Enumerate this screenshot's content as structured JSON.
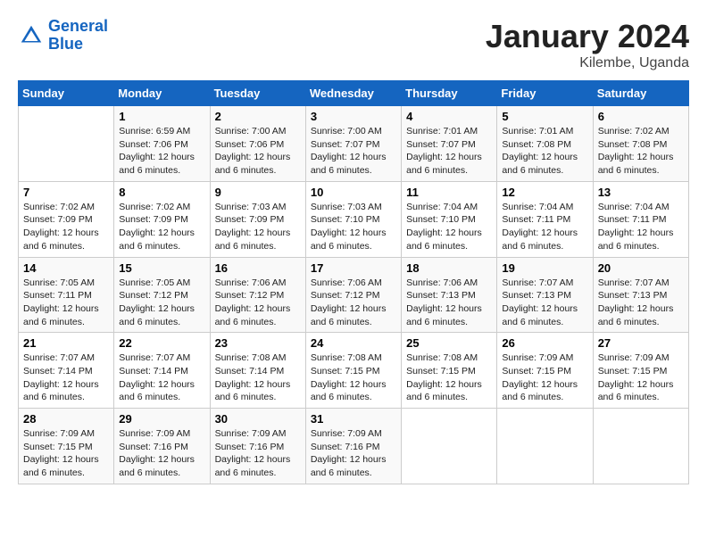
{
  "header": {
    "logo_line1": "General",
    "logo_line2": "Blue",
    "month_year": "January 2024",
    "location": "Kilembe, Uganda"
  },
  "weekdays": [
    "Sunday",
    "Monday",
    "Tuesday",
    "Wednesday",
    "Thursday",
    "Friday",
    "Saturday"
  ],
  "weeks": [
    [
      {
        "day": "",
        "sunrise": "",
        "sunset": "",
        "daylight": ""
      },
      {
        "day": "1",
        "sunrise": "Sunrise: 6:59 AM",
        "sunset": "Sunset: 7:06 PM",
        "daylight": "Daylight: 12 hours and 6 minutes."
      },
      {
        "day": "2",
        "sunrise": "Sunrise: 7:00 AM",
        "sunset": "Sunset: 7:06 PM",
        "daylight": "Daylight: 12 hours and 6 minutes."
      },
      {
        "day": "3",
        "sunrise": "Sunrise: 7:00 AM",
        "sunset": "Sunset: 7:07 PM",
        "daylight": "Daylight: 12 hours and 6 minutes."
      },
      {
        "day": "4",
        "sunrise": "Sunrise: 7:01 AM",
        "sunset": "Sunset: 7:07 PM",
        "daylight": "Daylight: 12 hours and 6 minutes."
      },
      {
        "day": "5",
        "sunrise": "Sunrise: 7:01 AM",
        "sunset": "Sunset: 7:08 PM",
        "daylight": "Daylight: 12 hours and 6 minutes."
      },
      {
        "day": "6",
        "sunrise": "Sunrise: 7:02 AM",
        "sunset": "Sunset: 7:08 PM",
        "daylight": "Daylight: 12 hours and 6 minutes."
      }
    ],
    [
      {
        "day": "7",
        "sunrise": "Sunrise: 7:02 AM",
        "sunset": "Sunset: 7:09 PM",
        "daylight": "Daylight: 12 hours and 6 minutes."
      },
      {
        "day": "8",
        "sunrise": "Sunrise: 7:02 AM",
        "sunset": "Sunset: 7:09 PM",
        "daylight": "Daylight: 12 hours and 6 minutes."
      },
      {
        "day": "9",
        "sunrise": "Sunrise: 7:03 AM",
        "sunset": "Sunset: 7:09 PM",
        "daylight": "Daylight: 12 hours and 6 minutes."
      },
      {
        "day": "10",
        "sunrise": "Sunrise: 7:03 AM",
        "sunset": "Sunset: 7:10 PM",
        "daylight": "Daylight: 12 hours and 6 minutes."
      },
      {
        "day": "11",
        "sunrise": "Sunrise: 7:04 AM",
        "sunset": "Sunset: 7:10 PM",
        "daylight": "Daylight: 12 hours and 6 minutes."
      },
      {
        "day": "12",
        "sunrise": "Sunrise: 7:04 AM",
        "sunset": "Sunset: 7:11 PM",
        "daylight": "Daylight: 12 hours and 6 minutes."
      },
      {
        "day": "13",
        "sunrise": "Sunrise: 7:04 AM",
        "sunset": "Sunset: 7:11 PM",
        "daylight": "Daylight: 12 hours and 6 minutes."
      }
    ],
    [
      {
        "day": "14",
        "sunrise": "Sunrise: 7:05 AM",
        "sunset": "Sunset: 7:11 PM",
        "daylight": "Daylight: 12 hours and 6 minutes."
      },
      {
        "day": "15",
        "sunrise": "Sunrise: 7:05 AM",
        "sunset": "Sunset: 7:12 PM",
        "daylight": "Daylight: 12 hours and 6 minutes."
      },
      {
        "day": "16",
        "sunrise": "Sunrise: 7:06 AM",
        "sunset": "Sunset: 7:12 PM",
        "daylight": "Daylight: 12 hours and 6 minutes."
      },
      {
        "day": "17",
        "sunrise": "Sunrise: 7:06 AM",
        "sunset": "Sunset: 7:12 PM",
        "daylight": "Daylight: 12 hours and 6 minutes."
      },
      {
        "day": "18",
        "sunrise": "Sunrise: 7:06 AM",
        "sunset": "Sunset: 7:13 PM",
        "daylight": "Daylight: 12 hours and 6 minutes."
      },
      {
        "day": "19",
        "sunrise": "Sunrise: 7:07 AM",
        "sunset": "Sunset: 7:13 PM",
        "daylight": "Daylight: 12 hours and 6 minutes."
      },
      {
        "day": "20",
        "sunrise": "Sunrise: 7:07 AM",
        "sunset": "Sunset: 7:13 PM",
        "daylight": "Daylight: 12 hours and 6 minutes."
      }
    ],
    [
      {
        "day": "21",
        "sunrise": "Sunrise: 7:07 AM",
        "sunset": "Sunset: 7:14 PM",
        "daylight": "Daylight: 12 hours and 6 minutes."
      },
      {
        "day": "22",
        "sunrise": "Sunrise: 7:07 AM",
        "sunset": "Sunset: 7:14 PM",
        "daylight": "Daylight: 12 hours and 6 minutes."
      },
      {
        "day": "23",
        "sunrise": "Sunrise: 7:08 AM",
        "sunset": "Sunset: 7:14 PM",
        "daylight": "Daylight: 12 hours and 6 minutes."
      },
      {
        "day": "24",
        "sunrise": "Sunrise: 7:08 AM",
        "sunset": "Sunset: 7:15 PM",
        "daylight": "Daylight: 12 hours and 6 minutes."
      },
      {
        "day": "25",
        "sunrise": "Sunrise: 7:08 AM",
        "sunset": "Sunset: 7:15 PM",
        "daylight": "Daylight: 12 hours and 6 minutes."
      },
      {
        "day": "26",
        "sunrise": "Sunrise: 7:09 AM",
        "sunset": "Sunset: 7:15 PM",
        "daylight": "Daylight: 12 hours and 6 minutes."
      },
      {
        "day": "27",
        "sunrise": "Sunrise: 7:09 AM",
        "sunset": "Sunset: 7:15 PM",
        "daylight": "Daylight: 12 hours and 6 minutes."
      }
    ],
    [
      {
        "day": "28",
        "sunrise": "Sunrise: 7:09 AM",
        "sunset": "Sunset: 7:15 PM",
        "daylight": "Daylight: 12 hours and 6 minutes."
      },
      {
        "day": "29",
        "sunrise": "Sunrise: 7:09 AM",
        "sunset": "Sunset: 7:16 PM",
        "daylight": "Daylight: 12 hours and 6 minutes."
      },
      {
        "day": "30",
        "sunrise": "Sunrise: 7:09 AM",
        "sunset": "Sunset: 7:16 PM",
        "daylight": "Daylight: 12 hours and 6 minutes."
      },
      {
        "day": "31",
        "sunrise": "Sunrise: 7:09 AM",
        "sunset": "Sunset: 7:16 PM",
        "daylight": "Daylight: 12 hours and 6 minutes."
      },
      {
        "day": "",
        "sunrise": "",
        "sunset": "",
        "daylight": ""
      },
      {
        "day": "",
        "sunrise": "",
        "sunset": "",
        "daylight": ""
      },
      {
        "day": "",
        "sunrise": "",
        "sunset": "",
        "daylight": ""
      }
    ]
  ]
}
